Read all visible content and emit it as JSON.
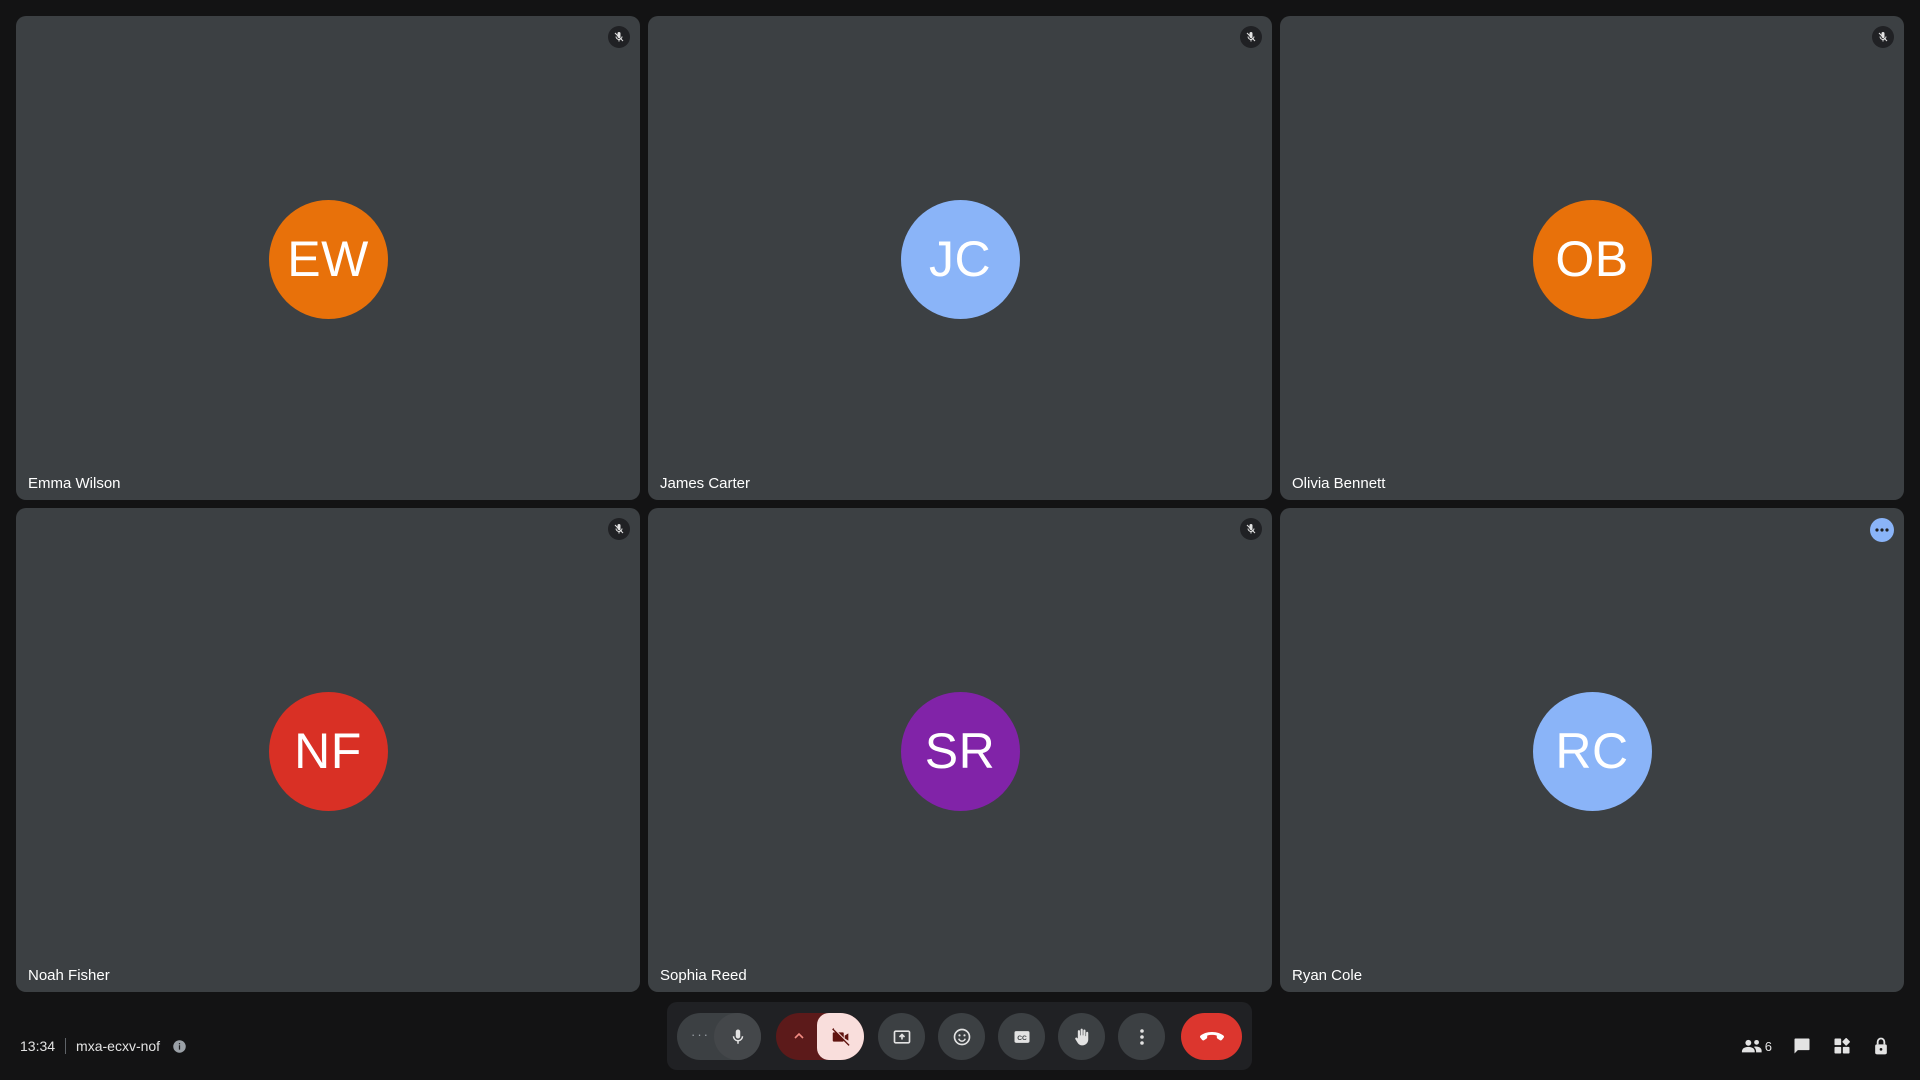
{
  "participants": [
    {
      "name": "Emma Wilson",
      "initials": "EW",
      "avatar_color": "#e8710a",
      "status": "muted"
    },
    {
      "name": "James Carter",
      "initials": "JC",
      "avatar_color": "#8ab4f8",
      "status": "muted"
    },
    {
      "name": "Olivia Bennett",
      "initials": "OB",
      "avatar_color": "#e8710a",
      "status": "muted"
    },
    {
      "name": "Noah Fisher",
      "initials": "NF",
      "avatar_color": "#d93025",
      "status": "muted"
    },
    {
      "name": "Sophia Reed",
      "initials": "SR",
      "avatar_color": "#8123a8",
      "status": "muted"
    },
    {
      "name": "Ryan Cole",
      "initials": "RC",
      "avatar_color": "#8ab4f8",
      "status": "options"
    }
  ],
  "meeting": {
    "time": "13:34",
    "code": "mxa-ecxv-nof"
  },
  "controls": {
    "mic_options_glyph": "···",
    "icons": [
      "more-options-icon",
      "microphone-icon",
      "chevron-up-icon",
      "camera-off-icon",
      "present-screen-icon",
      "emoji-icon",
      "captions-icon",
      "raise-hand-icon",
      "more-vert-icon",
      "end-call-icon"
    ]
  },
  "right_bar": {
    "people_count": "6",
    "icons": [
      "people-icon",
      "chat-icon",
      "activities-icon",
      "host-controls-icon"
    ]
  },
  "colors": {
    "background": "#131314",
    "tile": "#3c4043",
    "end_call": "#dc362e",
    "camera_off_bg": "#f9dedc",
    "camera_off_pill": "#5c1a1a"
  }
}
